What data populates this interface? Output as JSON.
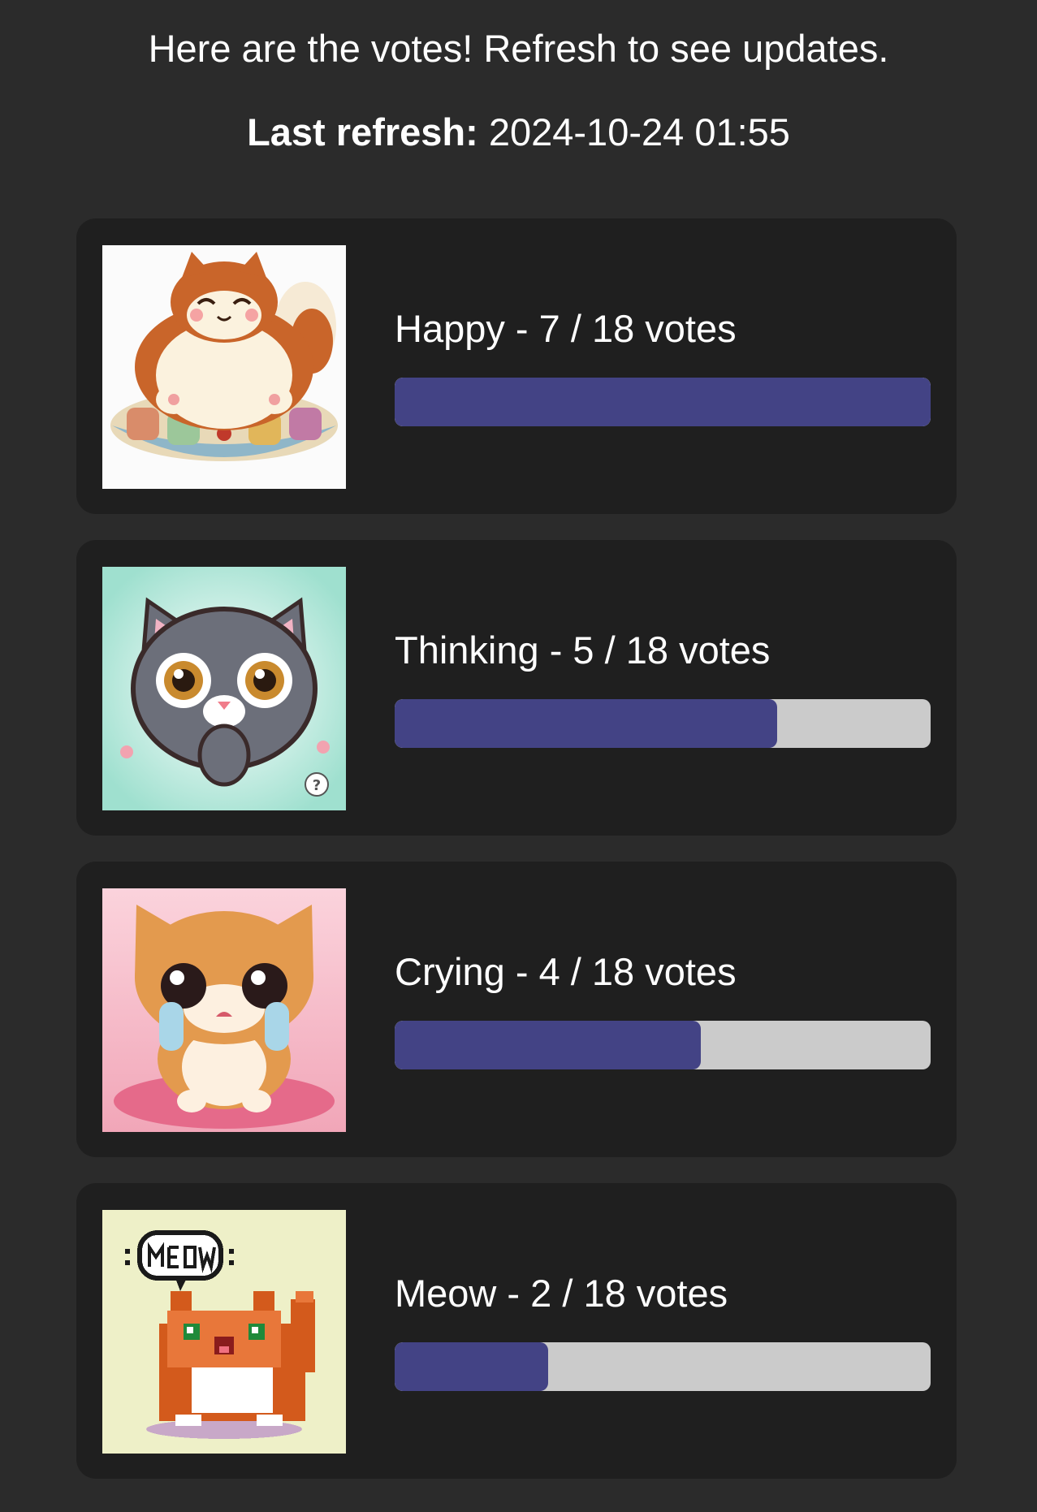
{
  "header": {
    "message": "Here are the votes! Refresh to see updates.",
    "last_refresh_label": "Last refresh:",
    "last_refresh_value": "2024-10-24 01:55"
  },
  "results": [
    {
      "name": "Happy",
      "votes": 7,
      "total": 18,
      "label": "Happy - 7 / 18 votes",
      "image": "happy-cat-on-cushion"
    },
    {
      "name": "Thinking",
      "votes": 5,
      "total": 18,
      "label": "Thinking - 5 / 18 votes",
      "image": "thinking-gray-cat"
    },
    {
      "name": "Crying",
      "votes": 4,
      "total": 18,
      "label": "Crying - 4 / 18 votes",
      "image": "crying-orange-cat"
    },
    {
      "name": "Meow",
      "votes": 2,
      "total": 18,
      "label": "Meow - 2 / 18 votes",
      "image": "pixel-meow-cat"
    }
  ],
  "colors": {
    "page_bg": "#2b2b2b",
    "card_bg": "#1f1f1f",
    "bar_fill": "#434385",
    "bar_track": "#cbcbcb"
  }
}
